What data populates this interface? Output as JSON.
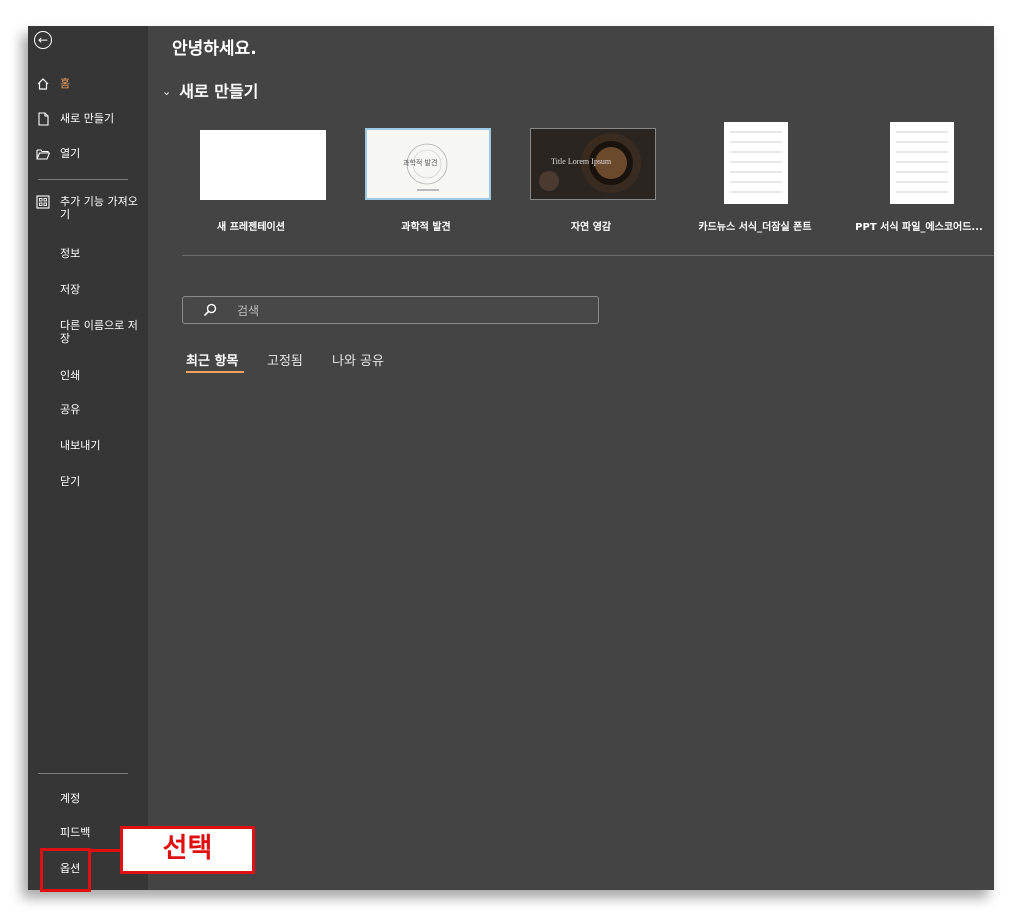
{
  "sidebar": {
    "back_icon": "arrow-left-circle-icon",
    "items": [
      {
        "label": "홈",
        "icon": "home-icon"
      },
      {
        "label": "새로 만들기",
        "icon": "new-document-icon"
      },
      {
        "label": "열기",
        "icon": "folder-open-icon"
      },
      {
        "label": "추가 기능 가져오기",
        "icon": "add-ins-grid-icon"
      },
      {
        "label": "정보"
      },
      {
        "label": "저장"
      },
      {
        "label": "다른 이름으로 저장"
      },
      {
        "label": "인쇄"
      },
      {
        "label": "공유"
      },
      {
        "label": "내보내기"
      },
      {
        "label": "닫기"
      }
    ],
    "footer": [
      {
        "label": "계정"
      },
      {
        "label": "피드백"
      },
      {
        "label": "옵션"
      }
    ]
  },
  "main": {
    "greeting": "안녕하세요.",
    "new_section_title": "새로 만들기",
    "templates": [
      {
        "caption": "새 프레젠테이션"
      },
      {
        "caption": "과학적 발견",
        "thumb_text": "과학적 발견"
      },
      {
        "caption": "자연 영감",
        "thumb_text": "Title Lorem Ipsum"
      },
      {
        "caption": "카드뉴스 서식_더잠실 폰트"
      },
      {
        "caption": "PPT 서식 파일_에스코어드..."
      }
    ],
    "search_placeholder": "검색",
    "tabs": [
      {
        "label": "최근 항목"
      },
      {
        "label": "고정됨"
      },
      {
        "label": "나와 공유"
      }
    ]
  },
  "annotation": {
    "callout_text": "선택"
  },
  "colors": {
    "sidebar_bg": "#363636",
    "main_bg": "#444444",
    "accent": "#f0a35f",
    "highlight": "#e01010"
  }
}
